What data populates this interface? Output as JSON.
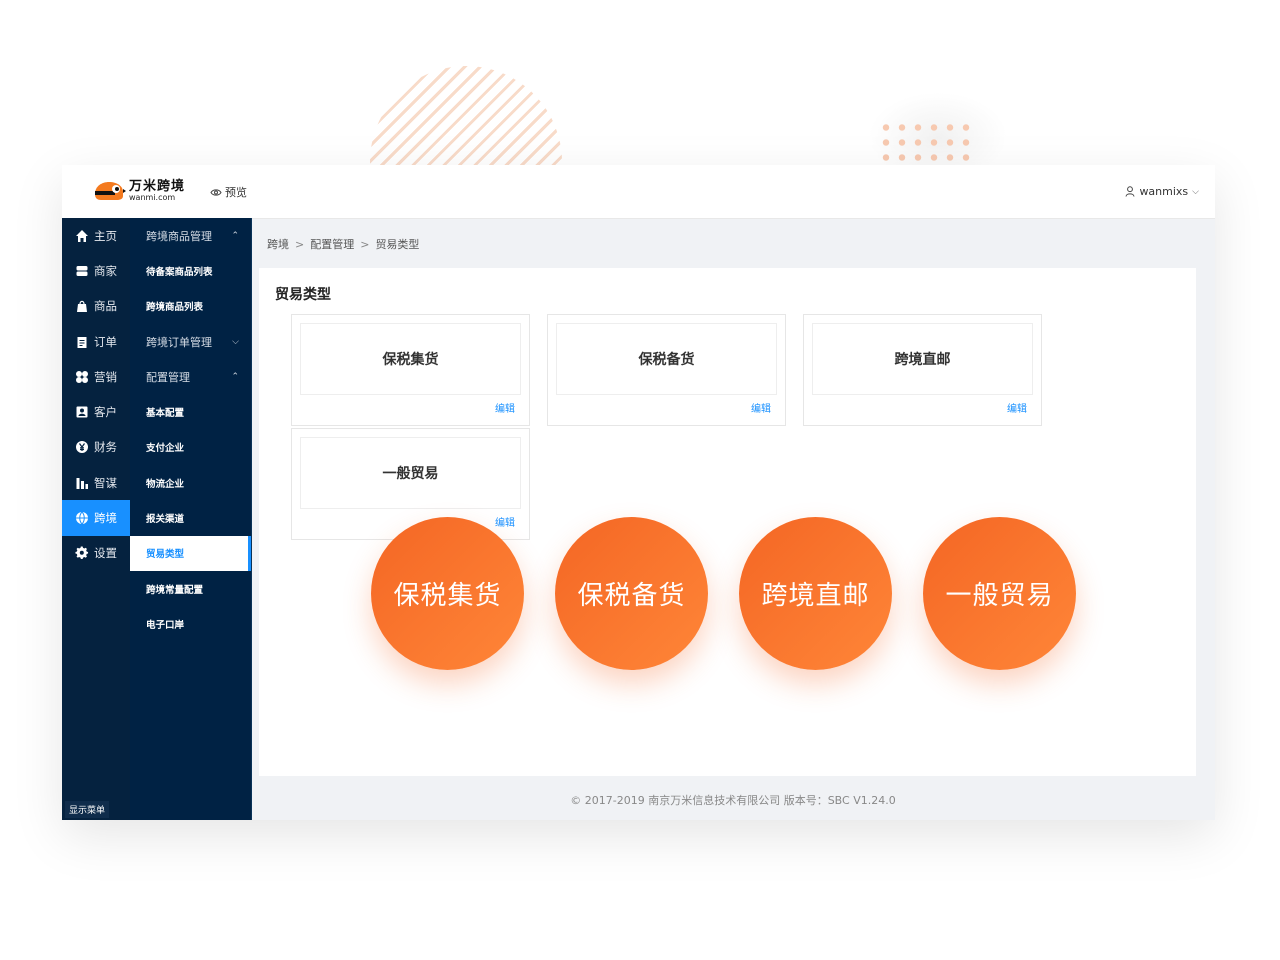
{
  "app": {
    "logo_cn": "万米跨境",
    "logo_en": "wanmi.com",
    "preview_label": "预览",
    "username": "wanmixs"
  },
  "nav_primary": [
    {
      "label": "主页",
      "icon": "home-icon"
    },
    {
      "label": "商家",
      "icon": "store-icon"
    },
    {
      "label": "商品",
      "icon": "shopping-bag-icon"
    },
    {
      "label": "订单",
      "icon": "clipboard-icon"
    },
    {
      "label": "营销",
      "icon": "clover-icon"
    },
    {
      "label": "客户",
      "icon": "user-card-icon"
    },
    {
      "label": "财务",
      "icon": "yen-icon"
    },
    {
      "label": "智谋",
      "icon": "bar-chart-icon"
    },
    {
      "label": "跨境",
      "icon": "globe-icon",
      "active": true
    },
    {
      "label": "设置",
      "icon": "gear-icon"
    }
  ],
  "show_menu_label": "显示菜单",
  "nav_secondary": [
    {
      "label": "跨境商品管理",
      "type": "group",
      "chevron": "up"
    },
    {
      "label": "待备案商品列表",
      "type": "sub"
    },
    {
      "label": "跨境商品列表",
      "type": "sub"
    },
    {
      "label": "跨境订单管理",
      "type": "group",
      "chevron": "down"
    },
    {
      "label": "配置管理",
      "type": "group",
      "chevron": "up"
    },
    {
      "label": "基本配置",
      "type": "sub"
    },
    {
      "label": "支付企业",
      "type": "sub"
    },
    {
      "label": "物流企业",
      "type": "sub"
    },
    {
      "label": "报关渠道",
      "type": "sub"
    },
    {
      "label": "贸易类型",
      "type": "sub",
      "selected": true
    },
    {
      "label": "跨境常量配置",
      "type": "sub"
    },
    {
      "label": "电子口岸",
      "type": "sub"
    }
  ],
  "breadcrumb": [
    "跨境",
    "配置管理",
    "贸易类型"
  ],
  "page_title": "贸易类型",
  "cards": [
    {
      "name": "保税集货",
      "edit_label": "编辑"
    },
    {
      "name": "保税备货",
      "edit_label": "编辑"
    },
    {
      "name": "跨境直邮",
      "edit_label": "编辑"
    },
    {
      "name": "一般贸易",
      "edit_label": "编辑"
    }
  ],
  "footer": "© 2017-2019 南京万米信息技术有限公司 版本号：SBC V1.24.0",
  "bubbles": [
    "保税集货",
    "保税备货",
    "跨境直邮",
    "一般贸易"
  ],
  "colors": {
    "accent": "#1890ff",
    "sidebar": "#002244",
    "bubble": "#f46624"
  }
}
